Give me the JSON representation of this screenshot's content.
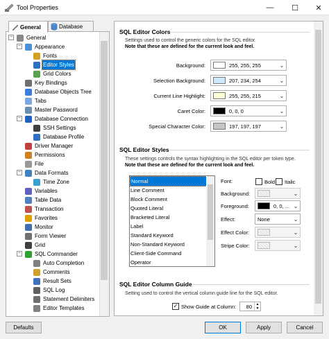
{
  "window": {
    "title": "Tool Properties",
    "minimize": "—",
    "maximize": "☐",
    "close": "✕"
  },
  "tabs": [
    {
      "label": "General",
      "icon": "wrench-icon"
    },
    {
      "label": "Database",
      "icon": "database-icon"
    }
  ],
  "tree": [
    {
      "label": "General",
      "level": 0,
      "expand": "−",
      "icon": "wrench-icon",
      "color": "#888888"
    },
    {
      "label": "Appearance",
      "level": 1,
      "expand": "−",
      "icon": "appearance-icon",
      "color": "#4a90d9"
    },
    {
      "label": "Fonts",
      "level": 2,
      "expand": "",
      "icon": "fonts-icon",
      "color": "#d4a020"
    },
    {
      "label": "Editor Styles",
      "level": 2,
      "expand": "",
      "icon": "editor-styles-icon",
      "color": "#3070c0",
      "selected": true
    },
    {
      "label": "Grid Colors",
      "level": 2,
      "expand": "",
      "icon": "grid-colors-icon",
      "color": "#5aa050"
    },
    {
      "label": "Key Bindings",
      "level": 1,
      "expand": "",
      "icon": "keyboard-icon",
      "color": "#707070"
    },
    {
      "label": "Database Objects Tree",
      "level": 1,
      "expand": "",
      "icon": "tree-icon",
      "color": "#3b7dd8"
    },
    {
      "label": "Tabs",
      "level": 1,
      "expand": "",
      "icon": "tabs-icon",
      "color": "#7aa7e0"
    },
    {
      "label": "Master Password",
      "level": 1,
      "expand": "",
      "icon": "key-icon",
      "color": "#6a8fb0"
    },
    {
      "label": "Database Connection",
      "level": 1,
      "expand": "−",
      "icon": "connection-icon",
      "color": "#2060c0"
    },
    {
      "label": "SSH Settings",
      "level": 2,
      "expand": "",
      "icon": "ssh-icon",
      "color": "#404040"
    },
    {
      "label": "Database Profile",
      "level": 2,
      "expand": "",
      "icon": "profile-icon",
      "color": "#3070c0"
    },
    {
      "label": "Driver Manager",
      "level": 1,
      "expand": "",
      "icon": "driver-icon",
      "color": "#c04040"
    },
    {
      "label": "Permissions",
      "level": 1,
      "expand": "",
      "icon": "permissions-icon",
      "color": "#d08020"
    },
    {
      "label": "File",
      "level": 1,
      "expand": "",
      "icon": "file-icon",
      "color": "#999999"
    },
    {
      "label": "Data Formats",
      "level": 1,
      "expand": "−",
      "icon": "data-formats-icon",
      "color": "#4080c0"
    },
    {
      "label": "Time Zone",
      "level": 2,
      "expand": "",
      "icon": "globe-icon",
      "color": "#3aa0d0"
    },
    {
      "label": "Variables",
      "level": 1,
      "expand": "",
      "icon": "variables-icon",
      "color": "#6060c0"
    },
    {
      "label": "Table Data",
      "level": 1,
      "expand": "",
      "icon": "table-icon",
      "color": "#5080c0"
    },
    {
      "label": "Transaction",
      "level": 1,
      "expand": "",
      "icon": "transaction-icon",
      "color": "#c05050"
    },
    {
      "label": "Favorites",
      "level": 1,
      "expand": "",
      "icon": "star-icon",
      "color": "#e0a000"
    },
    {
      "label": "Monitor",
      "level": 1,
      "expand": "",
      "icon": "monitor-icon",
      "color": "#4070b0"
    },
    {
      "label": "Form Viewer",
      "level": 1,
      "expand": "",
      "icon": "form-icon",
      "color": "#707070"
    },
    {
      "label": "Grid",
      "level": 1,
      "expand": "",
      "icon": "grid-icon",
      "color": "#404040"
    },
    {
      "label": "SQL Commander",
      "level": 1,
      "expand": "−",
      "icon": "play-icon",
      "color": "#30a030"
    },
    {
      "label": "Auto Completion",
      "level": 2,
      "expand": "",
      "icon": "completion-icon",
      "color": "#808080"
    },
    {
      "label": "Comments",
      "level": 2,
      "expand": "",
      "icon": "comments-icon",
      "color": "#d0a030"
    },
    {
      "label": "Result Sets",
      "level": 2,
      "expand": "",
      "icon": "result-sets-icon",
      "color": "#4070c0"
    },
    {
      "label": "SQL Log",
      "level": 2,
      "expand": "",
      "icon": "log-icon",
      "color": "#606060"
    },
    {
      "label": "Statement Delimiters",
      "level": 2,
      "expand": "",
      "icon": "delimiters-icon",
      "color": "#707070"
    },
    {
      "label": "Editor Templates",
      "level": 2,
      "expand": "",
      "icon": "templates-icon",
      "color": "#808080"
    }
  ],
  "colors_section": {
    "title": "SQL Editor Colors",
    "desc1": "Settings used to control the generic colors for the SQL editor.",
    "desc2": "Note that these are defined for the current look and feel.",
    "fields": [
      {
        "label": "Background:",
        "swatch": "#ffffff",
        "value": "255, 255, 255"
      },
      {
        "label": "Selection Background:",
        "swatch": "#cfeafe",
        "value": "207, 234, 254"
      },
      {
        "label": "Current Line Highlight:",
        "swatch": "#ffffd7",
        "value": "255, 255, 215"
      },
      {
        "label": "Caret Color:",
        "swatch": "#000000",
        "value": "0, 0, 0"
      },
      {
        "label": "Special Character Color:",
        "swatch": "#c5c5c5",
        "value": "197, 197, 197"
      }
    ]
  },
  "styles_section": {
    "title": "SQL Editor Styles",
    "desc1": "These settings controls the syntax highlighting in the SQL editor per token type.",
    "desc2": "Note that these are defined for the current look and feel.",
    "tokens": [
      "Normal",
      "Line Comment",
      "Block Comment",
      "Quoted Literal",
      "Bracketed Literal",
      "Label",
      "Standard Keyword",
      "Non-Standard Keyword",
      "Client-Side Command",
      "Operator"
    ],
    "selected_index": 0,
    "font_label": "Font:",
    "bold_label": "Bold",
    "italic_label": "Italic",
    "background_label": "Background:",
    "foreground_label": "Foreground:",
    "foreground_value": "0, 0, ...",
    "foreground_swatch": "#000000",
    "effect_label": "Effect:",
    "effect_value": "None",
    "effect_color_label": "Effect Color:",
    "stripe_color_label": "Stripe Color:"
  },
  "guide_section": {
    "title": "SQL Editor Column Guide",
    "desc": "Setting used to control the vertical column guide line for the SQL editor.",
    "checkbox_label": "Show Guide at Column:",
    "checked": true,
    "column_value": "80"
  },
  "buttons": {
    "defaults": "Defaults",
    "ok": "OK",
    "apply": "Apply",
    "cancel": "Cancel"
  }
}
